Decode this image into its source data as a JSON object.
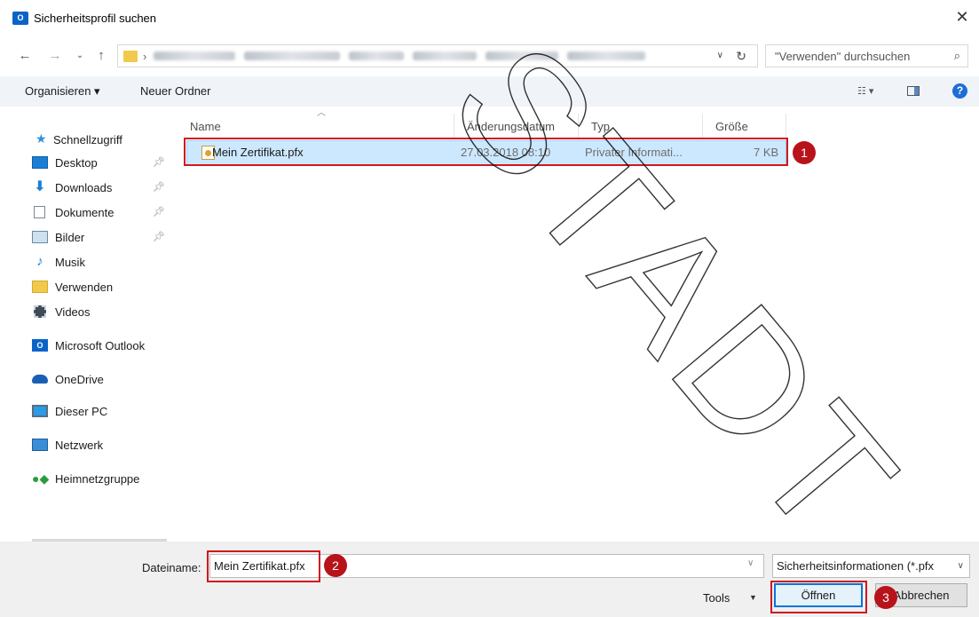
{
  "window": {
    "icon_text": "O",
    "title": "Sicherheitsprofil suchen",
    "close_label": "✕"
  },
  "address": {
    "breadcrumb_sep": "›",
    "refresh_glyph": "↻",
    "search_placeholder": "\"Verwenden\" durchsuchen"
  },
  "toolbar": {
    "organize_label": "Organisieren ▾",
    "new_folder_label": "Neuer Ordner",
    "help_label": "?"
  },
  "sidebar": {
    "quick_access": "Schnellzugriff",
    "items": [
      {
        "label": "Desktop"
      },
      {
        "label": "Downloads"
      },
      {
        "label": "Dokumente"
      },
      {
        "label": "Bilder"
      },
      {
        "label": "Musik"
      },
      {
        "label": "Verwenden"
      },
      {
        "label": "Videos"
      }
    ],
    "outlook": "Microsoft Outlook",
    "onedrive": "OneDrive",
    "this_pc": "Dieser PC",
    "network": "Netzwerk",
    "homegroup": "Heimnetzgruppe"
  },
  "columns": {
    "name": "Name",
    "date": "Änderungsdatum",
    "type": "Typ",
    "size": "Größe"
  },
  "files": [
    {
      "name": "Mein Zertifikat.pfx",
      "date": "27.03.2018 08:10",
      "type": "Privater Informati...",
      "size": "7 KB"
    }
  ],
  "bottom": {
    "filename_label": "Dateiname:",
    "filename_value": "Mein Zertifikat.pfx",
    "filetype_value": "Sicherheitsinformationen (*.pfx",
    "tools_label": "Tools",
    "open_label": "Öffnen",
    "cancel_label": "Abbrechen"
  },
  "annotations": {
    "badge1": "1",
    "badge2": "2",
    "badge3": "3",
    "color": "#d0181e"
  },
  "watermark": {
    "text": "STADT",
    "color": "#000000"
  }
}
